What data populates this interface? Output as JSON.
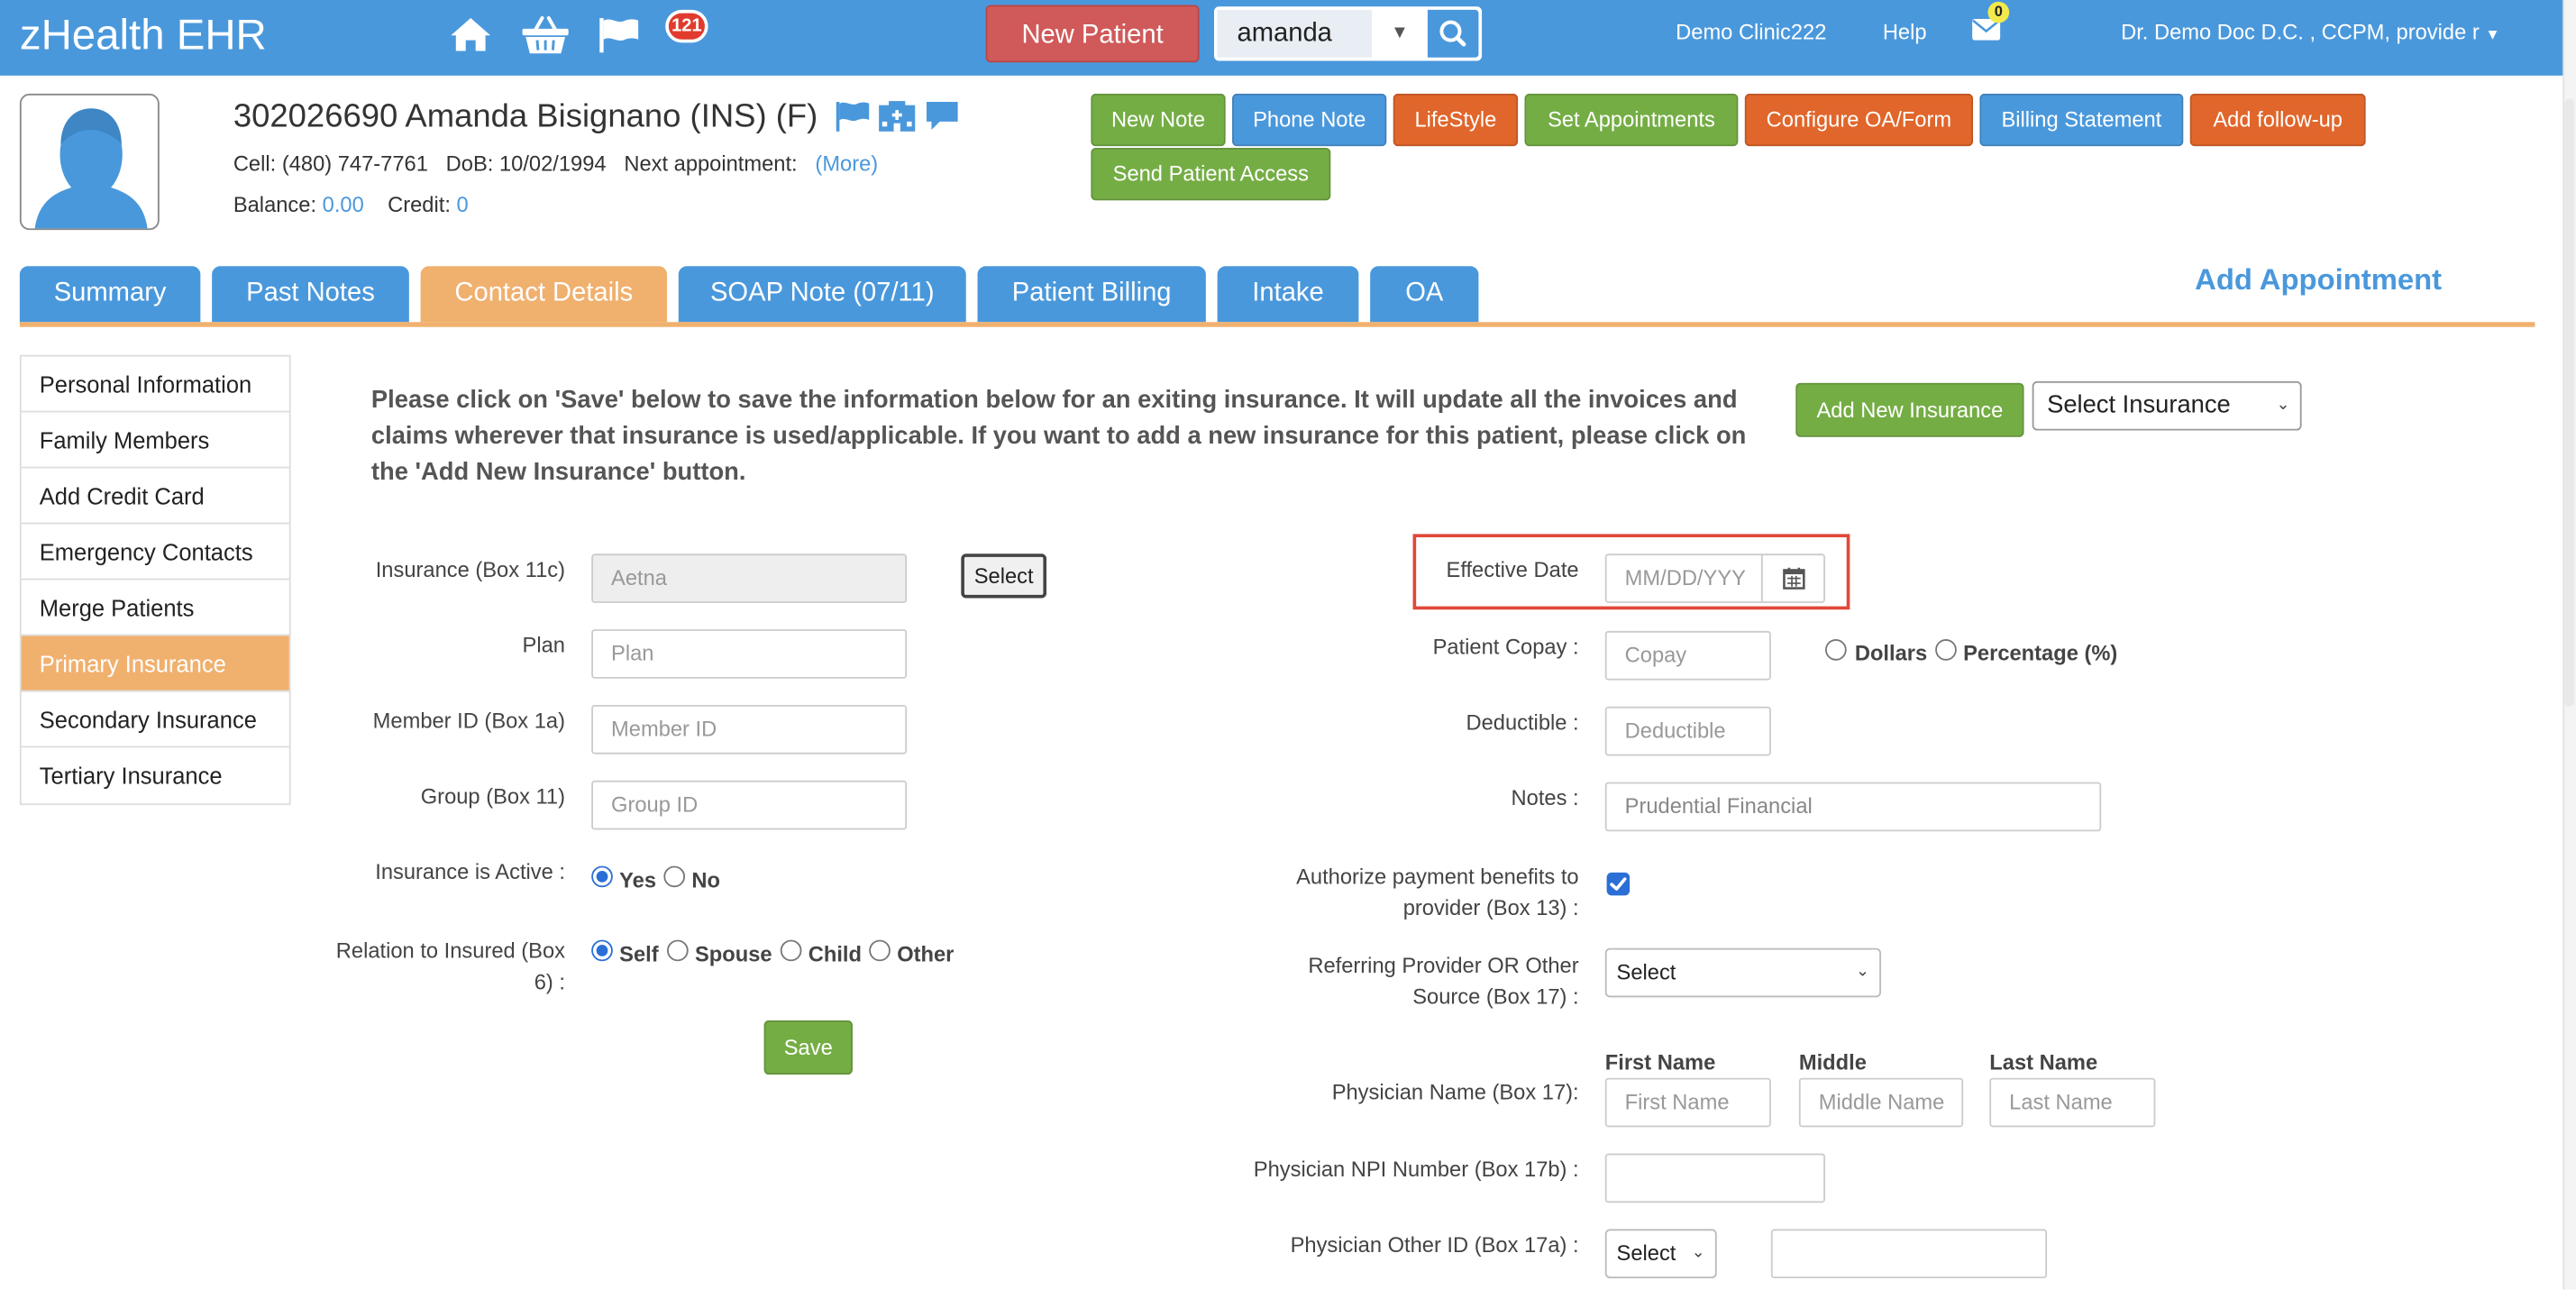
{
  "app": {
    "title": "zHealth EHR"
  },
  "topbar": {
    "notification_count": "121",
    "new_patient_label": "New Patient",
    "search_value": "amanda",
    "clinic": "Demo Clinic222",
    "help": "Help",
    "mail_count": "0",
    "user": "Dr. Demo Doc D.C. , CCPM, provide r",
    "icons": [
      "home-icon",
      "shopping-basket-icon",
      "flag-icon",
      "search-icon",
      "envelope-icon"
    ]
  },
  "patient": {
    "name_line": "302026690 Amanda Bisignano  (INS) (F)",
    "cell_label": "Cell:",
    "cell": "(480) 747-7761",
    "dob_label": "DoB:",
    "dob": "10/02/1994",
    "next_appt_label": "Next appointment:",
    "more": "(More)",
    "balance_label": "Balance:",
    "balance": "0.00",
    "credit_label": "Credit:",
    "credit": "0"
  },
  "actions": [
    {
      "label": "New Note",
      "color": "#75ad45"
    },
    {
      "label": "Phone Note",
      "color": "#4a98dc"
    },
    {
      "label": "LifeStyle",
      "color": "#e0662b"
    },
    {
      "label": "Set Appointments",
      "color": "#75ad45"
    },
    {
      "label": "Configure OA/Form",
      "color": "#e0662b"
    },
    {
      "label": "Billing Statement",
      "color": "#4a98dc"
    },
    {
      "label": "Add follow-up",
      "color": "#e0662b"
    },
    {
      "label": "Send Patient Access",
      "color": "#75ad45"
    }
  ],
  "tabs": [
    "Summary",
    "Past Notes",
    "Contact Details",
    "SOAP Note (07/11)",
    "Patient Billing",
    "Intake",
    "OA"
  ],
  "active_tab": "Contact Details",
  "add_appointment": "Add Appointment",
  "side_menu": [
    "Personal Information",
    "Family Members",
    "Add Credit Card",
    "Emergency Contacts",
    "Merge Patients",
    "Primary Insurance",
    "Secondary Insurance",
    "Tertiary Insurance"
  ],
  "active_side": "Primary Insurance",
  "notice": "Please click on 'Save' below to save the information below for an exiting insurance. It will update all the invoices and claims wherever that insurance is used/applicable. If you want to add a new insurance for this patient, please click on the 'Add New Insurance' button.",
  "add_new_insurance": "Add New Insurance",
  "select_insurance": "Select Insurance",
  "form_left": {
    "insurance_label": "Insurance (Box 11c)",
    "insurance_value": "Aetna",
    "select_btn": "Select",
    "plan_label": "Plan",
    "plan_placeholder": "Plan",
    "member_label": "Member ID (Box 1a)",
    "member_placeholder": "Member ID",
    "group_label": "Group (Box 11)",
    "group_placeholder": "Group ID",
    "active_label": "Insurance is Active :",
    "active_yes": "Yes",
    "active_no": "No",
    "relation_label_1": "Relation to Insured (Box",
    "relation_label_2": "6) :",
    "rel_self": "Self",
    "rel_spouse": "Spouse",
    "rel_child": "Child",
    "rel_other": "Other",
    "save": "Save"
  },
  "form_right": {
    "effective_label": "Effective Date",
    "effective_placeholder": "MM/DD/YYY",
    "copay_label": "Patient Copay :",
    "copay_placeholder": "Copay",
    "dollars": "Dollars",
    "percentage": "Percentage (%)",
    "deductible_label": "Deductible :",
    "deductible_placeholder": "Deductible",
    "notes_label": "Notes :",
    "notes_value": "Prudential Financial",
    "authorize_label_1": "Authorize payment benefits to",
    "authorize_label_2": "provider (Box 13) :",
    "authorize_checked": true,
    "referring_label_1": "Referring Provider OR Other",
    "referring_label_2": "Source (Box 17) :",
    "referring_value": "Select",
    "first_name_head": "First Name",
    "middle_head": "Middle",
    "last_name_head": "Last Name",
    "physician_label": "Physician Name (Box 17):",
    "first_placeholder": "First Name",
    "middle_placeholder": "Middle Name",
    "last_placeholder": "Last Name",
    "npi_label": "Physician NPI Number (Box 17b) :",
    "other_id_label": "Physician Other ID (Box 17a) :",
    "other_id_select": "Select"
  }
}
